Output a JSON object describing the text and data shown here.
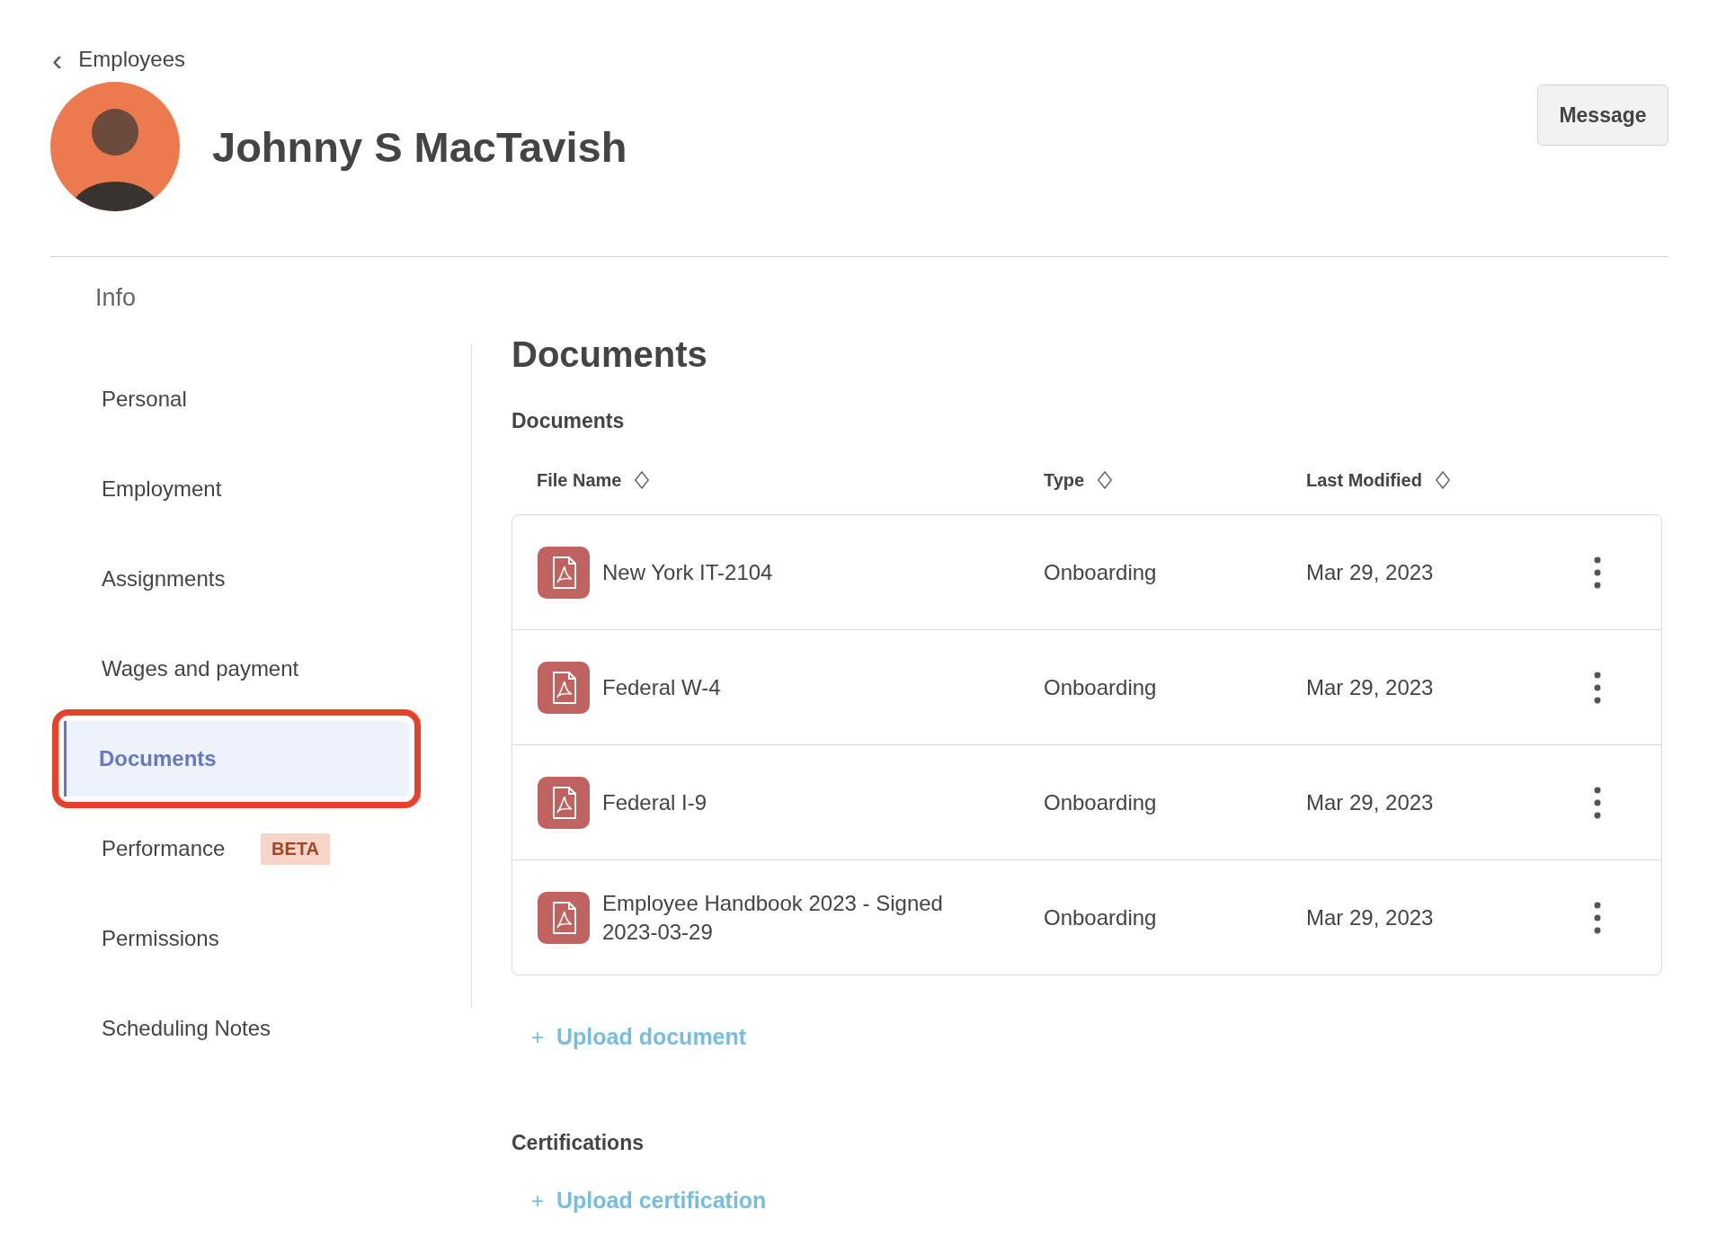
{
  "back_link": {
    "icon": "‹",
    "label": "Employees"
  },
  "header": {
    "name": "Johnny S MacTavish",
    "message_button": "Message"
  },
  "sidebar": {
    "heading": "Info",
    "items": [
      {
        "label": "Personal",
        "selected": false,
        "highlighted": false
      },
      {
        "label": "Employment",
        "selected": false,
        "highlighted": false
      },
      {
        "label": "Assignments",
        "selected": false,
        "highlighted": false
      },
      {
        "label": "Wages and payment",
        "selected": false,
        "highlighted": false
      },
      {
        "label": "Documents",
        "selected": true,
        "highlighted": true
      },
      {
        "label": "Performance",
        "selected": false,
        "highlighted": false,
        "badge": "BETA"
      },
      {
        "label": "Permissions",
        "selected": false,
        "highlighted": false
      },
      {
        "label": "Scheduling Notes",
        "selected": false,
        "highlighted": false
      }
    ]
  },
  "main": {
    "title": "Documents",
    "documents": {
      "heading": "Documents",
      "columns": [
        "File Name",
        "Type",
        "Last Modified"
      ],
      "rows": [
        {
          "file_name": "New York IT-2104",
          "type": "Onboarding",
          "last_modified": "Mar 29, 2023"
        },
        {
          "file_name": "Federal W-4",
          "type": "Onboarding",
          "last_modified": "Mar 29, 2023"
        },
        {
          "file_name": "Federal I-9",
          "type": "Onboarding",
          "last_modified": "Mar 29, 2023"
        },
        {
          "file_name": "Employee Handbook 2023 - Signed 2023-03-29",
          "type": "Onboarding",
          "last_modified": "Mar 29, 2023"
        }
      ],
      "upload": {
        "icon": "+",
        "label": "Upload document"
      }
    },
    "certifications": {
      "heading": "Certifications",
      "upload": {
        "icon": "+",
        "label": "Upload certification"
      }
    }
  }
}
